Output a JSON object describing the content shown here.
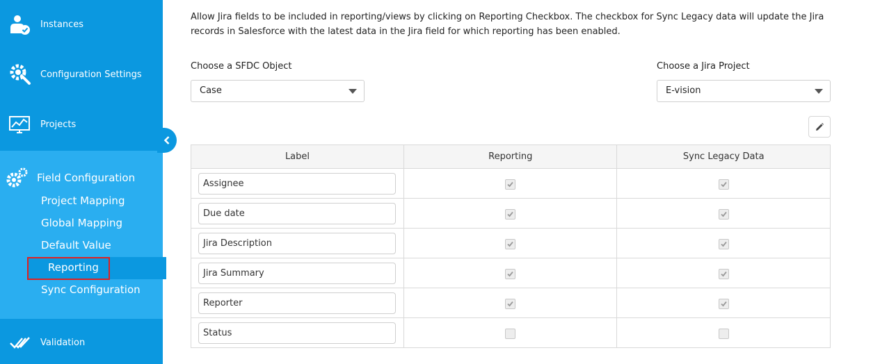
{
  "sidebar": {
    "instances": "Instances",
    "configuration_settings": "Configuration Settings",
    "projects": "Projects",
    "field_configuration": {
      "title": "Field Configuration",
      "items": [
        "Project Mapping",
        "Global Mapping",
        "Default Value",
        "Reporting",
        "Sync Configuration"
      ],
      "active": "Reporting"
    },
    "validation": "Validation"
  },
  "main": {
    "description": "Allow Jira fields to be included in reporting/views by clicking on Reporting Checkbox. The checkbox for Sync Legacy data will update the Jira records in Salesforce with the latest data in the Jira field for which reporting has been enabled.",
    "sfdc_label": "Choose a SFDC Object",
    "sfdc_value": "Case",
    "jira_label": "Choose a Jira Project",
    "jira_value": "E-vision",
    "table": {
      "headers": [
        "Label",
        "Reporting",
        "Sync Legacy Data"
      ],
      "rows": [
        {
          "label": "Assignee",
          "reporting": true,
          "sync": true
        },
        {
          "label": "Due date",
          "reporting": true,
          "sync": true
        },
        {
          "label": "Jira Description",
          "reporting": true,
          "sync": true
        },
        {
          "label": "Jira Summary",
          "reporting": true,
          "sync": true
        },
        {
          "label": "Reporter",
          "reporting": true,
          "sync": true
        },
        {
          "label": "Status",
          "reporting": false,
          "sync": false
        }
      ]
    }
  },
  "colors": {
    "sidebar_bg": "#0b98e0",
    "sidebar_group_bg": "#2aaef0",
    "highlight_border": "#e02020"
  },
  "icons": [
    "user-check-icon",
    "gear-wrench-icon",
    "monitor-chart-icon",
    "gears-icon",
    "double-check-icon",
    "chevron-left-icon",
    "pencil-icon",
    "checkmark-icon"
  ]
}
